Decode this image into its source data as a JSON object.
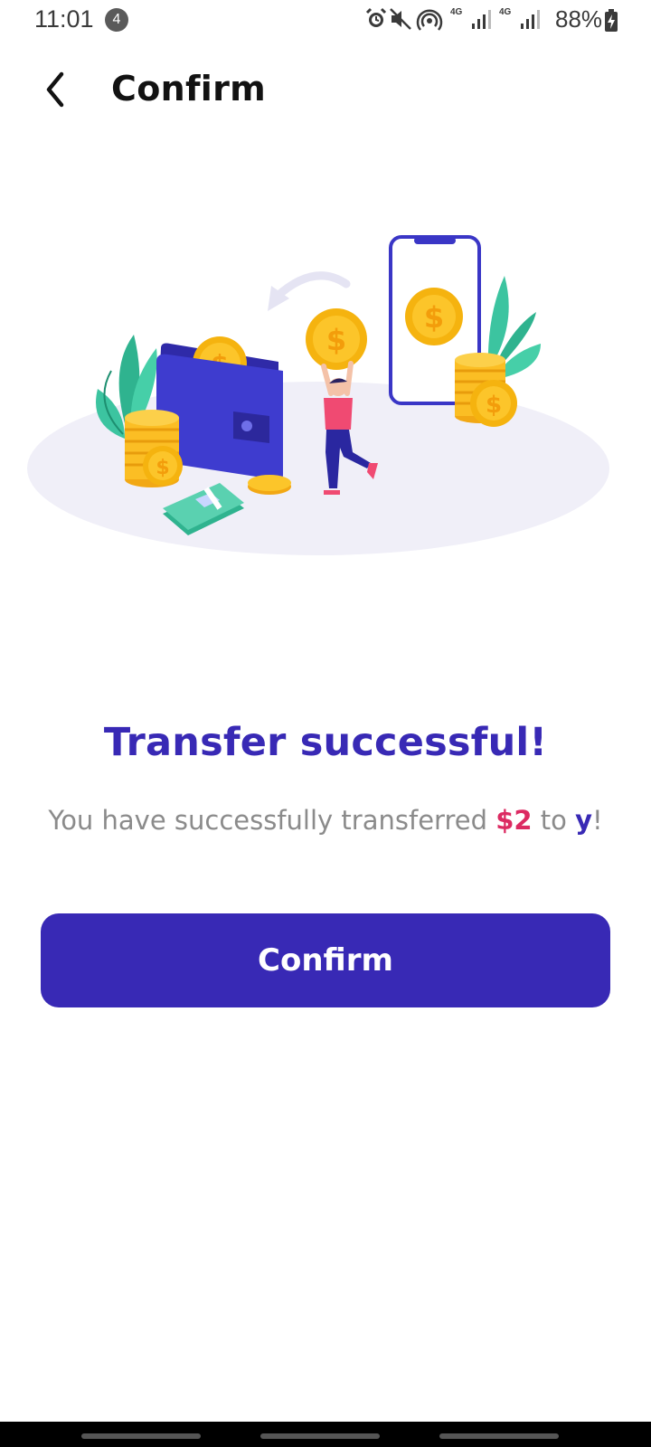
{
  "status_bar": {
    "time": "11:01",
    "notification_count": "4",
    "net_label_1": "4G",
    "net_label_2": "4G",
    "battery_text": "88%"
  },
  "app_bar": {
    "back_icon": "chevron-left-icon",
    "title": "Confirm"
  },
  "illustration": {
    "icons": [
      "wallet",
      "coin-stack",
      "dollar-coin",
      "phone",
      "banknotes",
      "person",
      "plant-leaves",
      "arrow-curved"
    ]
  },
  "result": {
    "headline": "Transfer successful!",
    "message_prefix": "You have successfully transferred ",
    "amount": "$2",
    "message_mid": " to ",
    "recipient": "y",
    "message_suffix": "!"
  },
  "actions": {
    "confirm_label": "Confirm"
  },
  "colors": {
    "primary": "#3829b5",
    "amount": "#dc2a62",
    "secondary_text": "#8b8b8b"
  }
}
